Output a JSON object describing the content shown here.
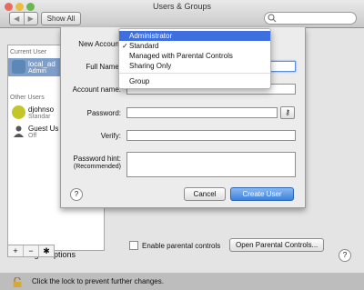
{
  "window": {
    "title": "Users & Groups",
    "nav_back": "◀",
    "nav_forward": "▶",
    "show_all": "Show All"
  },
  "sidebar": {
    "current_user_header": "Current User",
    "other_users_header": "Other Users",
    "users": [
      {
        "name": "local_ad",
        "role": "Admin"
      },
      {
        "name": "djohnso",
        "role": "Standar"
      },
      {
        "name": "Guest Us",
        "role": "Off"
      }
    ],
    "login_options": "Login Options",
    "tools": [
      "+",
      "−",
      "✱"
    ]
  },
  "sheet": {
    "new_account_label": "New Account",
    "full_name_label": "Full Name:",
    "account_name_label": "Account name:",
    "password_label": "Password:",
    "verify_label": "Verify:",
    "hint_label": "Password hint:",
    "hint_sub": "(Recommended)",
    "key_icon": "⚷",
    "help": "?",
    "cancel": "Cancel",
    "create": "Create User"
  },
  "menu": {
    "items": [
      {
        "label": "Administrator",
        "checked": false,
        "highlighted": true
      },
      {
        "label": "Standard",
        "checked": true,
        "highlighted": false
      },
      {
        "label": "Managed with Parental Controls",
        "checked": false,
        "highlighted": false
      },
      {
        "label": "Sharing Only",
        "checked": false,
        "highlighted": false
      },
      {
        "label": "Group",
        "checked": false,
        "highlighted": false
      }
    ],
    "check_glyph": "✓"
  },
  "main": {
    "enable_parental": "Enable parental controls",
    "open_parental": "Open Parental Controls...",
    "lock_text": "Click the lock to prevent further changes.",
    "help": "?"
  },
  "colors": {
    "selection": "#7f9fcb",
    "menu_highlight": "#3f6ede",
    "primary_button": "#3a82df"
  }
}
